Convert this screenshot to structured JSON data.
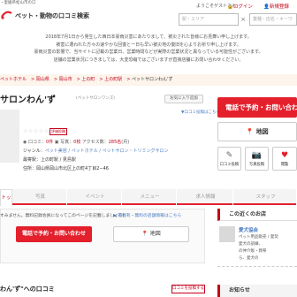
{
  "header": {
    "site_tag": "・愛媛県松山市の口",
    "logo_text": "ペット・動物の口コミ検索",
    "welcome": "ようこそゲストさん",
    "login": "ログイン",
    "register": "新規登録",
    "search_area_placeholder": "駅・エリア",
    "search_keyword_placeholder": "業種・店名・キーワ"
  },
  "notice": {
    "lines": [
      "2018年7月1日から発生した西日本豪雨災害にあたりまして、被災された皆様にお見舞い申し上げます。",
      "被害に遭われた方々の速やかな回復と一日も早い被災地の復旧を心よりお祈り申し上げます。",
      "豪雨災害の影響で、当サイトに記載の営業日、営業時間などが実際の営業状況と異なっている可能性がございます。",
      "店舗の営業状況につきましては、大変恐縮ではございますが直接店舗にお問い合わせください。"
    ]
  },
  "breadcrumb": {
    "items": [
      "ペットホテル",
      "岡山県",
      "岡山市",
      "上の町",
      "上の町駅"
    ],
    "current": "ペットサロンわん'ず"
  },
  "shop": {
    "name": "サロンわん'ず",
    "kana": "(ペットサロンワンズ)",
    "favorite": "お気に入り追加",
    "review_link": "▼口コミ投稿はこちら",
    "rate_button": "評価投稿",
    "stats": {
      "reviews_label": "口コミ",
      "reviews": "0件",
      "photos_label": "写真",
      "photos": "0枚",
      "access_label": "アクセス数",
      "access": "285名",
      "access_suffix": "(月)"
    },
    "genre_label": "ジャンル：",
    "genre_links": "ペット美容 / ペットホテル / ペットサロン・トリミングサロン",
    "station_label": "最寄駅：",
    "station_value": "上の町駅 / 見島駅",
    "address_label": "住所：",
    "address_value": "岡山県岡山市北区上の町4丁目2−46"
  },
  "actions": {
    "reserve": "電話で予約・お問い合わせ",
    "map": "地図",
    "review_post": "口コミ投稿",
    "photo_post": "写真投稿",
    "browse": "閲覧"
  },
  "tabs": [
    "トップ",
    "写真",
    "イベント",
    "メニュー",
    "求人情報",
    "スタッフ"
  ],
  "main": {
    "message": "すみません。無料記録会員になってこのページを記載しましょう！",
    "message_link": "▶ 掲載有・無料の店舗情報はこちら",
    "reserve": "電話で予約・お問い合わせ",
    "map": "地図",
    "reviews_head": "わん'ず\"への口コミ",
    "post_review": "口コミを投稿する"
  },
  "sidebar": {
    "nearby_head": "この近くのお店",
    "nearby_name": "愛犬協会",
    "nearby_lines": [
      "ペット用品販売 / 愛玩",
      "愛犬の訓練、",
      "の仲介販・葬祭",
      "ら、愛犬の"
    ],
    "section2_head": "お知らせ"
  },
  "colors": {
    "accent": "#e3202c",
    "link": "#4a7cc0"
  }
}
